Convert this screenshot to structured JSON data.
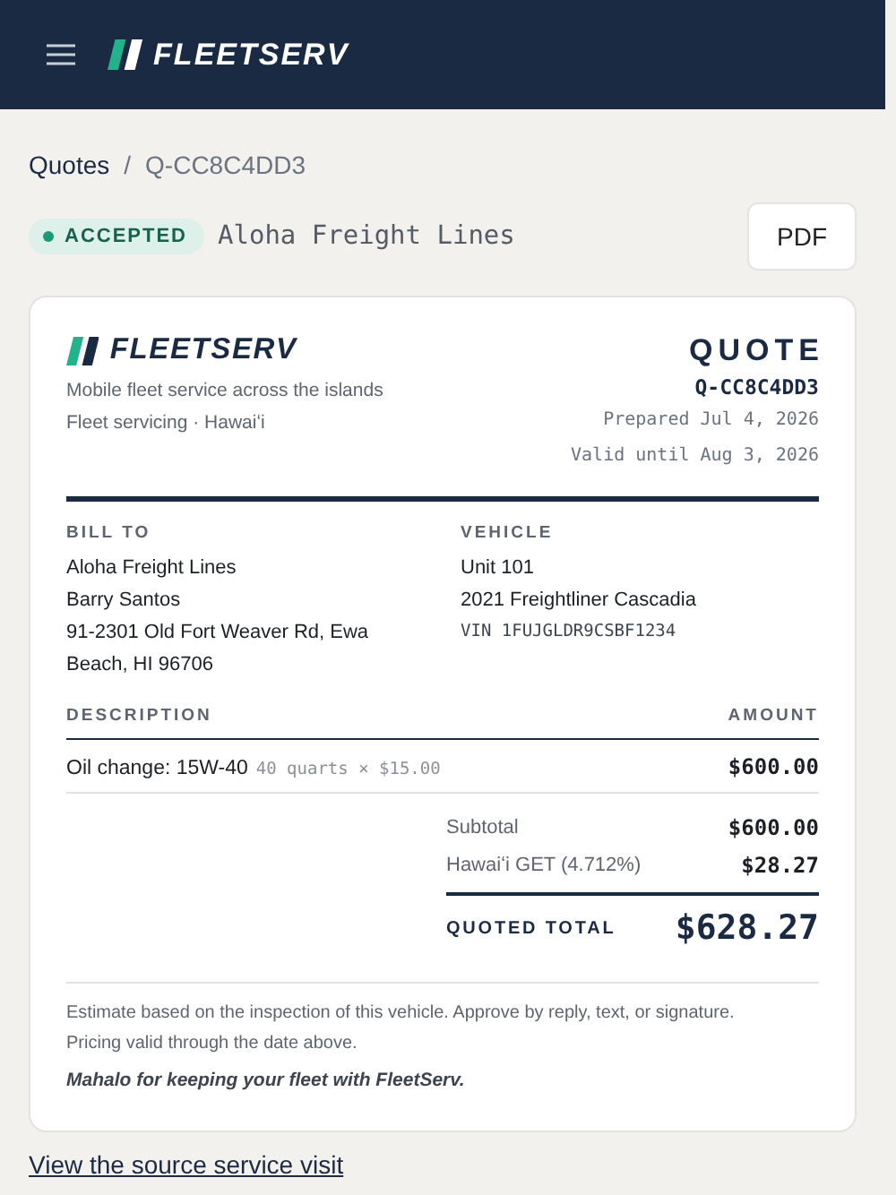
{
  "header": {
    "brand": "FLEETSERV"
  },
  "breadcrumb": {
    "separator": "/",
    "items": [
      {
        "label": "Quotes",
        "kind": "link"
      },
      {
        "label": "Q-CC8C4DD3",
        "kind": "current"
      }
    ]
  },
  "status": {
    "badge": "ACCEPTED",
    "customer": "Aloha Freight Lines",
    "button": "PDF"
  },
  "quote": {
    "brand": "FLEETSERV",
    "tagline": [
      "Mobile fleet service across the islands",
      "Fleet servicing · Hawaiʻi"
    ],
    "title": "QUOTE",
    "number": "Q-CC8C4DD3",
    "meta": [
      "Prepared Jul 4, 2026",
      "Valid until Aug 3, 2026"
    ],
    "parties": [
      {
        "heading": "BILL TO",
        "lines": [
          {
            "kind": "text",
            "text": "Aloha Freight Lines"
          },
          {
            "kind": "text",
            "text": "Barry Santos"
          },
          {
            "kind": "text",
            "text": "91-2301 Old Fort Weaver Rd, Ewa Beach, HI 96706"
          }
        ]
      },
      {
        "heading": "VEHICLE",
        "lines": [
          {
            "kind": "text",
            "text": "Unit 101"
          },
          {
            "kind": "text",
            "text": "2021 Freightliner Cascadia"
          },
          {
            "kind": "mono",
            "text": "VIN 1FUJGLDR9CSBF1234"
          }
        ]
      }
    ],
    "columns": [
      "DESCRIPTION",
      "AMOUNT"
    ],
    "rows": [
      {
        "description": "Oil change: 15W-40",
        "detail": "40 quarts × $15.00",
        "amount": "$600.00"
      }
    ],
    "totals": [
      {
        "label": "Subtotal",
        "amount": "$600.00"
      },
      {
        "label": "Hawaiʻi GET (4.712%)",
        "amount": "$28.27"
      }
    ],
    "grand_total": {
      "label": "QUOTED TOTAL",
      "amount": "$628.27"
    },
    "notes": [
      "Estimate based on the inspection of this vehicle. Approve by reply, text, or signature.",
      "Pricing valid through the date above."
    ],
    "thanks": "Mahalo for keeping your fleet with FleetServ."
  },
  "footer_link": "View the source service visit"
}
